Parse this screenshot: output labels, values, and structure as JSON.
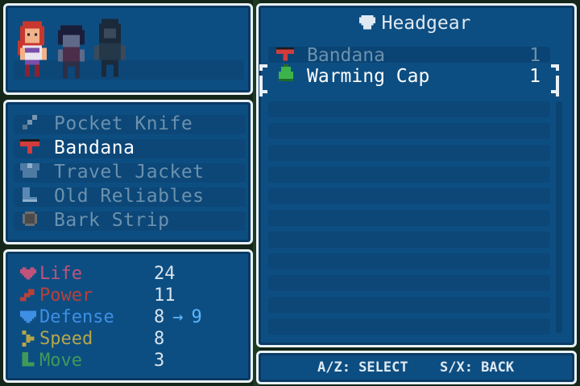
{
  "party": [
    {
      "name": "red-haired-hero",
      "active": true
    },
    {
      "name": "dark-haired-ally",
      "active": false
    },
    {
      "name": "hooded-ally",
      "active": false
    }
  ],
  "equipment": [
    {
      "slot": "weapon",
      "icon": "knife-icon",
      "label": "Pocket Knife",
      "active": false
    },
    {
      "slot": "headgear",
      "icon": "bandana-icon",
      "label": "Bandana",
      "active": true
    },
    {
      "slot": "armor",
      "icon": "jacket-icon",
      "label": "Travel Jacket",
      "active": false
    },
    {
      "slot": "boots",
      "icon": "boot-icon",
      "label": "Old Reliables",
      "active": false
    },
    {
      "slot": "accessory",
      "icon": "ring-icon",
      "label": "Bark Strip",
      "active": false
    }
  ],
  "stats": [
    {
      "name": "Life",
      "value": "24",
      "color": "#c2527a",
      "icon": "heart-icon"
    },
    {
      "name": "Power",
      "value": "11",
      "color": "#b5413b",
      "icon": "fist-icon"
    },
    {
      "name": "Defense",
      "value": "8",
      "new_value": "9",
      "arrow": "→",
      "color": "#3f8ee6",
      "icon": "shield-icon"
    },
    {
      "name": "Speed",
      "value": "8",
      "color": "#b6a64a",
      "icon": "chevron-icon"
    },
    {
      "name": "Move",
      "value": "3",
      "color": "#3f9a57",
      "icon": "boot-icon"
    }
  ],
  "category": {
    "title": "Headgear",
    "icon": "headgear-icon"
  },
  "items": [
    {
      "name": "Bandana",
      "count": "1",
      "icon": "bandana-icon",
      "selected": false
    },
    {
      "name": "Warming Cap",
      "count": "1",
      "icon": "cap-icon",
      "selected": true
    }
  ],
  "footer": {
    "select": "A/Z: SELECT",
    "back": "S/X: BACK"
  },
  "colors": {
    "panel": "#0d4e82",
    "border": "#e9f1f7",
    "dim_text": "#6b91ad",
    "highlight": "#5ab6ff"
  }
}
